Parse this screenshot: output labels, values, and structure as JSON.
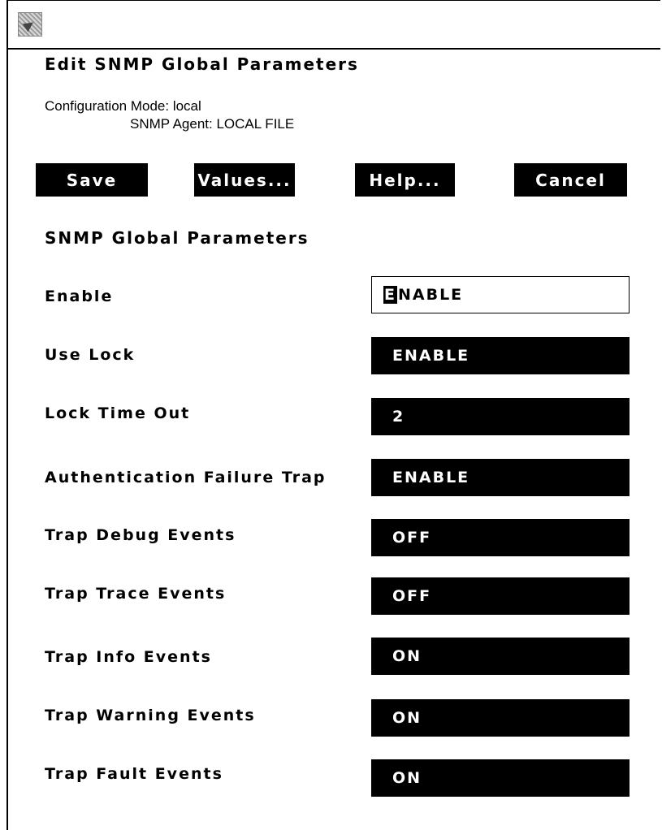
{
  "window": {
    "icon": "window-menu-icon"
  },
  "dialog": {
    "title": "Edit SNMP Global Parameters",
    "config_mode": "Configuration Mode: local",
    "snmp_agent": "SNMP Agent: LOCAL FILE"
  },
  "buttons": {
    "save": "Save",
    "values": "Values...",
    "help": "Help...",
    "cancel": "Cancel"
  },
  "section": {
    "title": "SNMP Global Parameters"
  },
  "params": [
    {
      "label": "Enable",
      "value": "ENABLE",
      "value_first": "E",
      "value_rest": "NABLE"
    },
    {
      "label": "Use Lock",
      "value": "ENABLE"
    },
    {
      "label": "Lock Time Out",
      "value": "2"
    },
    {
      "label": "Authentication Failure Trap",
      "value": "ENABLE"
    },
    {
      "label": "Trap Debug Events",
      "value": "OFF"
    },
    {
      "label": "Trap Trace Events",
      "value": "OFF"
    },
    {
      "label": "Trap Info Events",
      "value": "ON"
    },
    {
      "label": "Trap Warning Events",
      "value": "ON"
    },
    {
      "label": "Trap Fault Events",
      "value": "ON"
    }
  ],
  "colors": {
    "field_background": "#000000",
    "field_text": "#ffffff",
    "page_background": "#ffffff"
  }
}
